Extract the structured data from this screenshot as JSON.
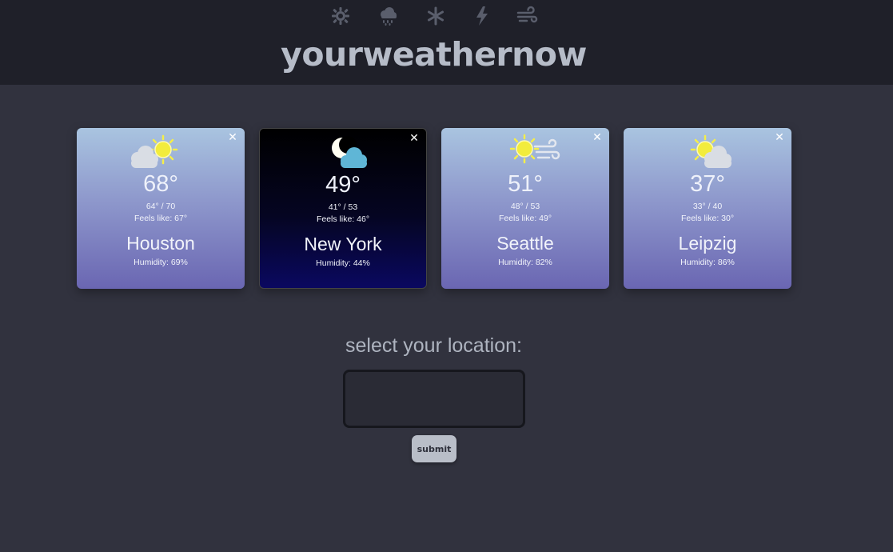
{
  "header": {
    "brand": "yourweathernow",
    "icons": [
      "sun-icon",
      "rain-cloud-icon",
      "snowflake-icon",
      "lightning-icon",
      "wind-icon"
    ]
  },
  "cards": [
    {
      "temp": "68°",
      "range": "64° / 70",
      "feels": "Feels like: 67°",
      "city": "Houston",
      "humidity": "Humidity: 69%",
      "icon": "partly-sunny-icon",
      "theme": "day",
      "close": "✕"
    },
    {
      "temp": "49°",
      "range": "41° / 53",
      "feels": "Feels like: 46°",
      "city": "New York",
      "humidity": "Humidity: 44%",
      "icon": "night-cloudy-icon",
      "theme": "night",
      "close": "✕"
    },
    {
      "temp": "51°",
      "range": "48° / 53",
      "feels": "Feels like: 49°",
      "city": "Seattle",
      "humidity": "Humidity: 82%",
      "icon": "sunny-windy-icon",
      "theme": "day",
      "close": "✕"
    },
    {
      "temp": "37°",
      "range": "33° / 40",
      "feels": "Feels like: 30°",
      "city": "Leipzig",
      "humidity": "Humidity: 86%",
      "icon": "partly-sunny-icon",
      "theme": "day",
      "close": "✕"
    }
  ],
  "location": {
    "label": "select your location:",
    "value": "",
    "placeholder": "",
    "submit_label": "submit"
  },
  "colors": {
    "background": "#31323e",
    "header": "#1f2029",
    "brand_text": "#b6bcc8",
    "sun": "#f2ec3c"
  }
}
